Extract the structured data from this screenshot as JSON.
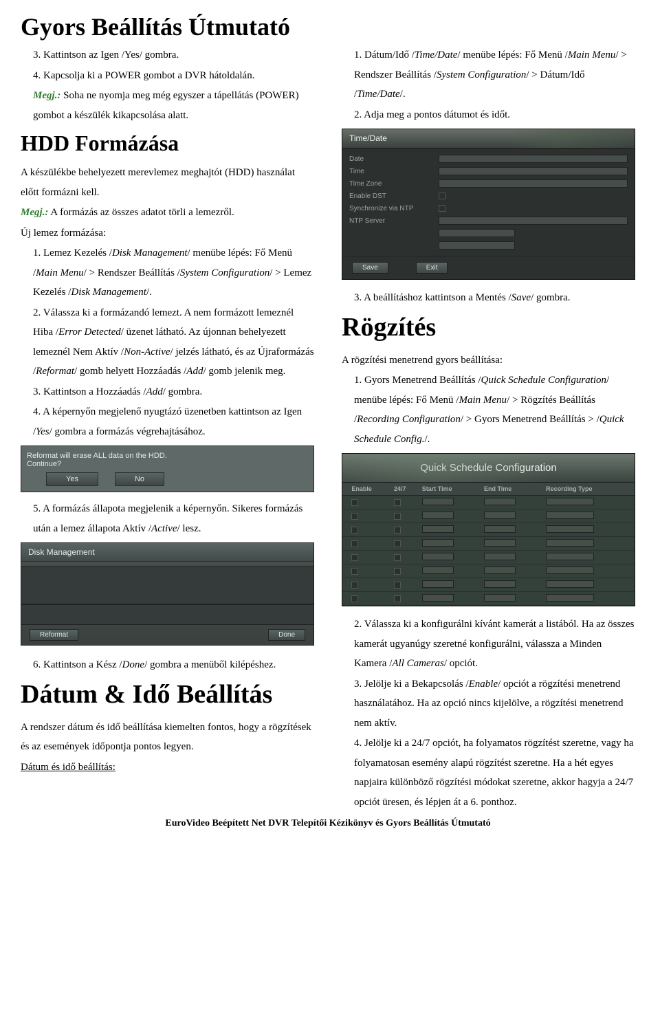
{
  "titles": {
    "page": "Gyors Beállítás Útmutató",
    "hdd": "HDD Formázása",
    "datetime": "Dátum & Idő Beállítás",
    "rogzites": "Rögzítés"
  },
  "left": {
    "l3": "3. Kattintson az Igen /Yes/ gombra.",
    "l4": "4. Kapcsolja ki a POWER gombot a DVR hátoldalán.",
    "megj1_label": "Megj.:",
    "megj1_body": " Soha ne nyomja meg még egyszer a tápellátás (POWER) gombot a készülék kikapcsolása alatt.",
    "hdd_intro1": "A készülékbe behelyezett merevlemez meghajtót (HDD) használat előtt formázni kell.",
    "megj2_label": "Megj.:",
    "megj2_body": " A formázás az összes adatot törli a lemezről.",
    "uj_lemez": "Új lemez formázása:",
    "s1a": "1. Lemez Kezelés /",
    "s1b": "Disk Management",
    "s1c": "/ menübe lépés: Fő Menü /",
    "s1d": "Main Menu",
    "s1e": "/ > Rendszer Beállítás /",
    "s1f": "System Configuration",
    "s1g": "/ > Lemez Kezelés /",
    "s1h": "Disk Management",
    "s1i": "/.",
    "s2a": "2. Válassza ki a formázandó lemezt. A nem formázott lemeznél Hiba /",
    "s2b": "Error Detected",
    "s2c": "/ üzenet látható. Az újonnan behelyezett lemeznél Nem Aktív /",
    "s2d": "Non-Active",
    "s2e": "/ jelzés látható, és az Újraformázás /",
    "s2f": "Reformat",
    "s2g": "/ gomb helyett Hozzáadás /",
    "s2h": "Add",
    "s2i": "/ gomb jelenik meg.",
    "s3a": "3. Kattintson a Hozzáadás /",
    "s3b": "Add",
    "s3c": "/ gombra.",
    "s4a": "4. A képernyőn megjelenő nyugtázó üzenetben kattintson az Igen /",
    "s4b": "Yes",
    "s4c": "/ gombra a formázás végrehajtásához.",
    "s5a": "5. A formázás állapota megjelenik a képernyőn. Sikeres formázás után a lemez állapota Aktív /",
    "s5b": "Active",
    "s5c": "/ lesz.",
    "s6a": "6. Kattintson a Kész /",
    "s6b": "Done",
    "s6c": "/ gombra a menüből kilépéshez.",
    "dt1": "A rendszer dátum és idő beállítása kiemelten fontos, hogy a rögzítések és az események időpontja pontos legyen.",
    "dt2": "Dátum és idő beállítás:"
  },
  "right": {
    "r1a": "1. Dátum/Idő /",
    "r1b": "Time/Date",
    "r1c": "/ menübe lépés: Fő Menü /",
    "r1d": "Main Menu",
    "r1e": "/ > Rendszer Beállítás /",
    "r1f": "System Configuration",
    "r1g": "/ > Dátum/Idő /",
    "r1h": "Time/Date",
    "r1i": "/.",
    "r2": "2. Adja meg a pontos dátumot és időt.",
    "r3a": "3. A beállításhoz kattintson a Mentés /",
    "r3b": "Save",
    "r3c": "/ gombra.",
    "rogz1": "A rögzítési menetrend gyors beállítása:",
    "rg1a": "1. Gyors Menetrend Beállítás /",
    "rg1b": "Quick Schedule Configuration",
    "rg1c": "/ menübe lépés: Fő Menü /",
    "rg1d": "Main Menu",
    "rg1e": "/ > Rögzítés Beállítás /",
    "rg1f": "Recording Configuration",
    "rg1g": "/ > Gyors Menetrend Beállítás > /",
    "rg1h": "Quick Schedule Config.",
    "rg1i": "/.",
    "rg2": "2. Válassza ki a konfigurálni kívánt kamerát a listából. Ha az összes kamerát ugyanúgy szeretné konfigurálni, válassza a Minden Kamera /",
    "rg2b": "All Cameras",
    "rg2c": "/ opciót.",
    "rg3": "3. Jelölje ki a Bekapcsolás /",
    "rg3b": "Enable",
    "rg3c": "/ opciót a rögzítési menetrend használatához. Ha az opció nincs kijelölve, a rögzítési menetrend nem aktív.",
    "rg4": "4. Jelölje ki a 24/7 opciót, ha folyamatos rögzítést szeretne, vagy ha folyamatosan esemény alapú rögzítést szeretne. Ha a hét egyes napjaira különböző rögzítési módokat szeretne, akkor hagyja a 24/7 opciót üresen, és lépjen át a 6. ponthoz."
  },
  "dialog": {
    "line1": "Reformat will erase ALL data on the HDD.",
    "line2": "Continue?",
    "yes": "Yes",
    "no": "No"
  },
  "disk_panel": {
    "title": "Disk Management",
    "reformat": "Reformat",
    "done": "Done"
  },
  "time_panel": {
    "title": "Time/Date",
    "rows": [
      "Date",
      "Time",
      "Time Zone",
      "Enable DST",
      "Synchronize via NTP",
      "NTP Server"
    ],
    "save": "Save",
    "exit": "Exit"
  },
  "qs_panel": {
    "title": "Quick Schedule Configuration",
    "cols": [
      "",
      "Enable",
      "24/7",
      "Start Time",
      "End Time",
      "Recording Type"
    ]
  },
  "footer": "EuroVideo Beépített Net DVR Telepítői Kézikönyv és Gyors Beállítás Útmutató"
}
